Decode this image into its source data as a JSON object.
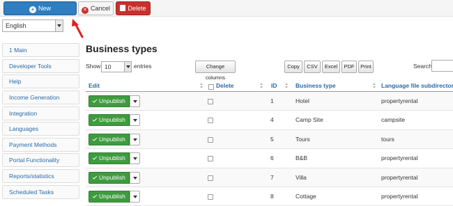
{
  "toolbar": {
    "new_label": "New",
    "cancel_label": "Cancel",
    "delete_label": "Delete"
  },
  "language": {
    "selected": "English"
  },
  "sidebar": {
    "items": [
      {
        "label": "1 Main"
      },
      {
        "label": "Developer Tools"
      },
      {
        "label": "Help"
      },
      {
        "label": "Income Generation"
      },
      {
        "label": "Integration"
      },
      {
        "label": "Languages"
      },
      {
        "label": "Payment Methods"
      },
      {
        "label": "Portal Functionality"
      },
      {
        "label": "Reports/statistics"
      },
      {
        "label": "Scheduled Tasks"
      }
    ]
  },
  "main": {
    "title": "Business types",
    "show_label": "Show",
    "entries_value": "10",
    "entries_label": "entries",
    "change_columns_label": "Change columns",
    "export_buttons": [
      "Copy",
      "CSV",
      "Excel",
      "PDF",
      "Print"
    ],
    "search_label": "Search:",
    "search_value": ""
  },
  "table": {
    "headers": {
      "edit": "Edit",
      "delete": "Delete",
      "id": "ID",
      "business_type": "Business type",
      "language_dir": "Language file subdirectory"
    },
    "unpublish_label": "Unpublish",
    "rows": [
      {
        "id": "1",
        "business_type": "Hotel",
        "language_dir": "propertyrental"
      },
      {
        "id": "4",
        "business_type": "Camp Site",
        "language_dir": "campsite"
      },
      {
        "id": "5",
        "business_type": "Tours",
        "language_dir": "tours"
      },
      {
        "id": "6",
        "business_type": "B&B",
        "language_dir": "propertyrental"
      },
      {
        "id": "7",
        "business_type": "Villa",
        "language_dir": "propertyrental"
      },
      {
        "id": "8",
        "business_type": "Cottage",
        "language_dir": "propertyrental"
      }
    ]
  },
  "colors": {
    "new_button": "#2f7ec0",
    "delete_button": "#c9302c",
    "unpublish_button": "#3e9b3e",
    "link_text": "#2a6aa6",
    "annotation_arrow": "#e02020"
  }
}
